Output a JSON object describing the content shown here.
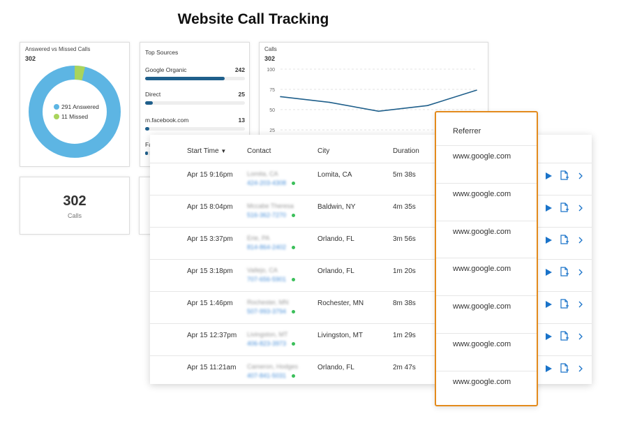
{
  "title": "Website Call Tracking",
  "answered_missed": {
    "title": "Answered vs Missed Calls",
    "total": "302",
    "answered_label": "291 Answered",
    "missed_label": "11 Missed",
    "answered": 291,
    "missed": 11,
    "colors": {
      "answered": "#5db5e3",
      "missed": "#a9d45c"
    }
  },
  "top_sources": {
    "title": "Top Sources",
    "items": [
      {
        "label": "Google Organic",
        "value": "242",
        "fraction": 0.8
      },
      {
        "label": "Direct",
        "value": "25",
        "fraction": 0.08
      },
      {
        "label": "m.facebook.com",
        "value": "13",
        "fraction": 0.04
      },
      {
        "label": "Fa",
        "value": "",
        "fraction": 0.03
      }
    ]
  },
  "calls_chart": {
    "title": "Calls",
    "total": "302",
    "chart_data": {
      "type": "line",
      "title": "Calls",
      "xlabel": "",
      "ylabel": "",
      "y_ticks": [
        "100",
        "75",
        "50",
        "25"
      ],
      "ylim": [
        25,
        100
      ],
      "series": [
        {
          "values": [
            66,
            59,
            48,
            55,
            74
          ]
        }
      ],
      "grid": true,
      "color": "#1f5f8b"
    }
  },
  "total_calls": {
    "value": "302",
    "label": "Calls"
  },
  "table": {
    "headers": {
      "start_time": "Start Time",
      "contact": "Contact",
      "city": "City",
      "duration": "Duration"
    },
    "sort_glyph": "▼",
    "rows": [
      {
        "start": "Apr 15 9:16pm",
        "name": "Lomita, CA",
        "phone": "424-203-4308",
        "city": "Lomita, CA",
        "duration": "5m 38s"
      },
      {
        "start": "Apr 15 8:04pm",
        "name": "Mccabe Theresa",
        "phone": "516-362-7270",
        "city": "Baldwin, NY",
        "duration": "4m 35s"
      },
      {
        "start": "Apr 15 3:37pm",
        "name": "Erie, PA",
        "phone": "814-864-2402",
        "city": "Orlando, FL",
        "duration": "3m 56s"
      },
      {
        "start": "Apr 15 3:18pm",
        "name": "Vallejo, CA",
        "phone": "707-656-5901",
        "city": "Orlando, FL",
        "duration": "1m 20s"
      },
      {
        "start": "Apr 15 1:46pm",
        "name": "Rochester, MN",
        "phone": "507-993-3794",
        "city": "Rochester, MN",
        "duration": "8m 38s"
      },
      {
        "start": "Apr 15 12:37pm",
        "name": "Livingston, MT",
        "phone": "406-823-3973",
        "city": "Livingston, MT",
        "duration": "1m 29s"
      },
      {
        "start": "Apr 15 11:21am",
        "name": "Cameron, Hodges",
        "phone": "407-841-5031",
        "city": "Orlando, FL",
        "duration": "2m 47s"
      }
    ]
  },
  "referrer": {
    "header": "Referrer",
    "values": [
      "www.google.com",
      "www.google.com",
      "www.google.com",
      "www.google.com",
      "www.google.com",
      "www.google.com",
      "www.google.com"
    ]
  },
  "icons": [
    "play-icon",
    "notes-icon",
    "chevron-right-icon"
  ],
  "accent_colors": {
    "brand": "#1f5f8b",
    "play": "#1a73c9",
    "highlight_border": "#e38a1c"
  }
}
